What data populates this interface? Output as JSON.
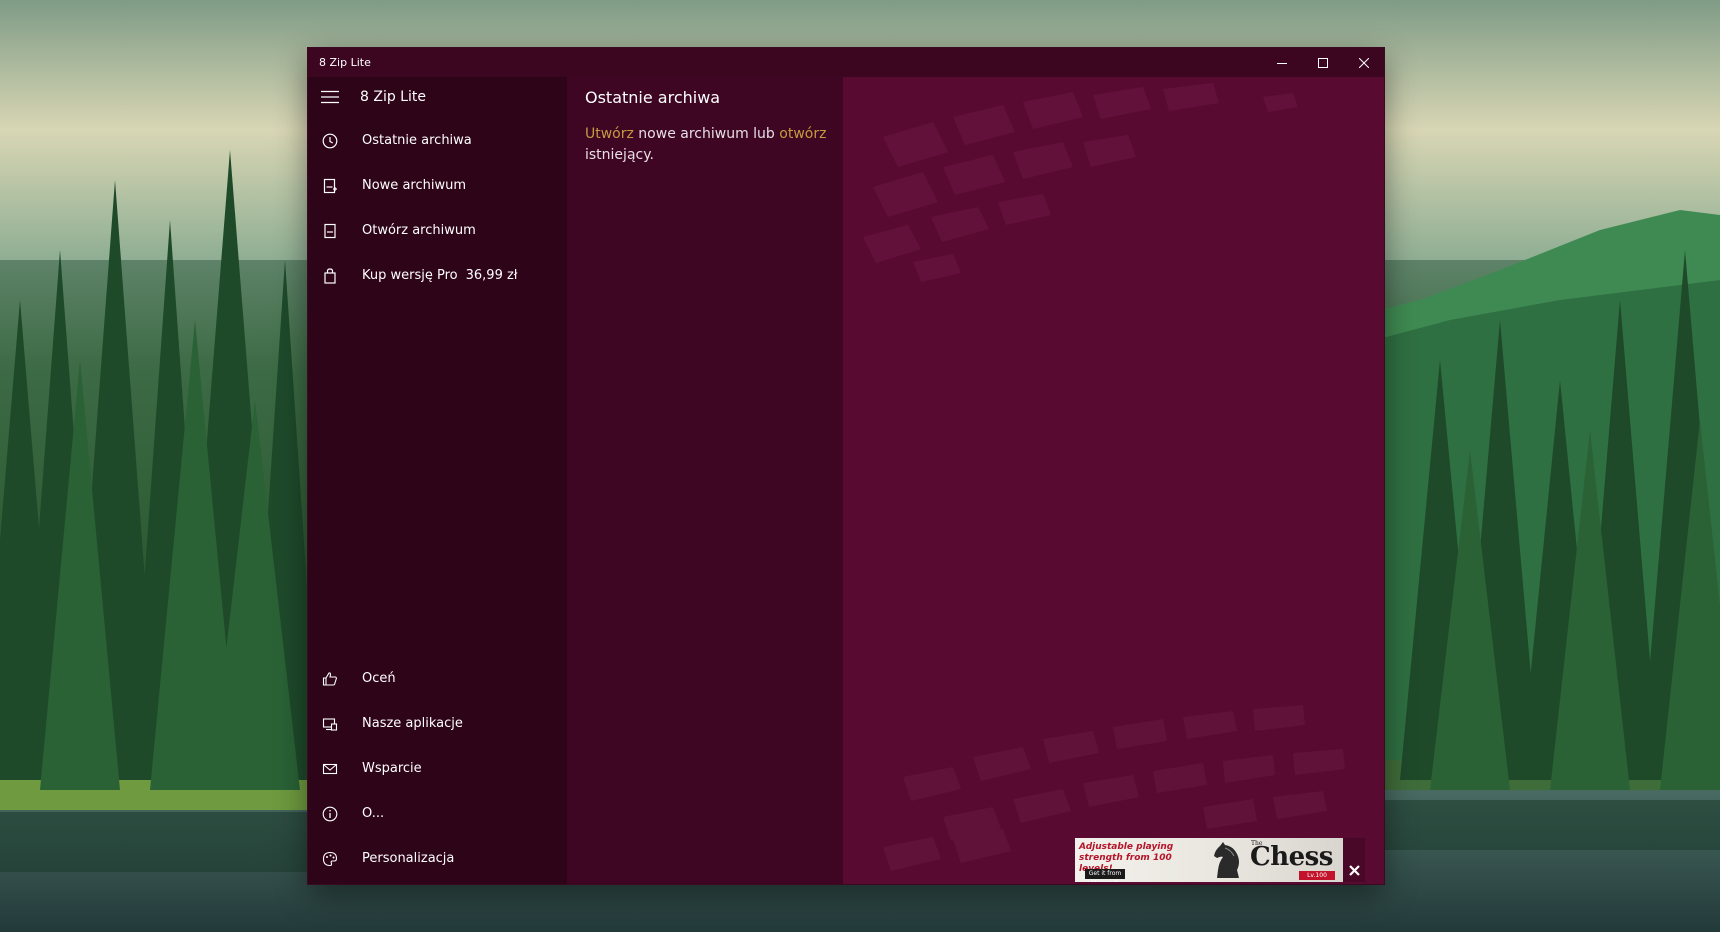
{
  "window": {
    "title": "8 Zip Lite",
    "colors": {
      "titlebar": "#3c0620",
      "nav": "#2e0418",
      "middle": "#3e0623",
      "content": "#590a31",
      "link": "#c79a3f"
    }
  },
  "nav": {
    "app_title": "8 Zip Lite",
    "top_items": [
      {
        "label": "Ostatnie archiwa",
        "icon": "clock-icon"
      },
      {
        "label": "Nowe archiwum",
        "icon": "new-archive-icon"
      },
      {
        "label": "Otwórz archiwum",
        "icon": "open-archive-icon"
      },
      {
        "label": "Kup wersję Pro",
        "price": "36,99 zł",
        "icon": "shopping-bag-icon"
      }
    ],
    "bottom_items": [
      {
        "label": "Oceń",
        "icon": "thumbs-up-icon"
      },
      {
        "label": "Nasze aplikacje",
        "icon": "apps-icon"
      },
      {
        "label": "Wsparcie",
        "icon": "mail-icon"
      },
      {
        "label": "O...",
        "icon": "info-icon"
      },
      {
        "label": "Personalizacja",
        "icon": "palette-icon"
      }
    ]
  },
  "recent": {
    "heading": "Ostatnie archiwa",
    "create_link": "Utwórz",
    "middle_text": " nowe archiwum lub ",
    "open_link": "otwórz",
    "end_text": " istniejący."
  },
  "ad": {
    "tagline": "Adjustable playing strength from 100 levels!",
    "badge": "Get it from Microsoft",
    "the": "The",
    "name": "Chess",
    "subtitle": "Lv.100"
  }
}
